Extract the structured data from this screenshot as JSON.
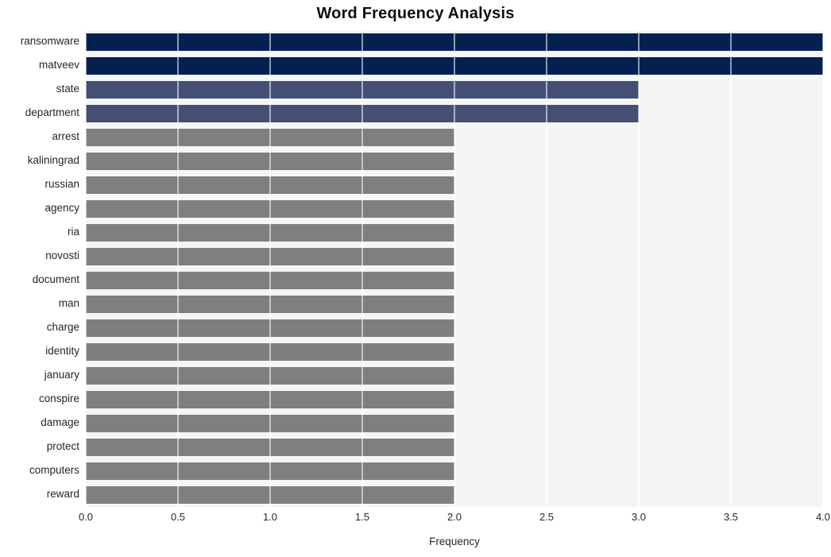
{
  "chart_data": {
    "type": "bar",
    "orientation": "horizontal",
    "title": "Word Frequency Analysis",
    "xlabel": "Frequency",
    "ylabel": "",
    "xlim": [
      0.0,
      4.0
    ],
    "xticks": [
      "0.0",
      "0.5",
      "1.0",
      "1.5",
      "2.0",
      "2.5",
      "3.0",
      "3.5",
      "4.0"
    ],
    "xtick_values": [
      0.0,
      0.5,
      1.0,
      1.5,
      2.0,
      2.5,
      3.0,
      3.5,
      4.0
    ],
    "grid": true,
    "grid_axis": "x",
    "legend": null,
    "categories": [
      "ransomware",
      "matveev",
      "state",
      "department",
      "arrest",
      "kaliningrad",
      "russian",
      "agency",
      "ria",
      "novosti",
      "document",
      "man",
      "charge",
      "identity",
      "january",
      "conspire",
      "damage",
      "protect",
      "computers",
      "reward"
    ],
    "values": [
      4,
      4,
      3,
      3,
      2,
      2,
      2,
      2,
      2,
      2,
      2,
      2,
      2,
      2,
      2,
      2,
      2,
      2,
      2,
      2
    ],
    "bar_colors": [
      "#042050",
      "#042050",
      "#454f74",
      "#454f74",
      "#7f7f7f",
      "#7f7f7f",
      "#7f7f7f",
      "#7f7f7f",
      "#7f7f7f",
      "#7f7f7f",
      "#7f7f7f",
      "#7f7f7f",
      "#7f7f7f",
      "#7f7f7f",
      "#7f7f7f",
      "#7f7f7f",
      "#7f7f7f",
      "#7f7f7f",
      "#7f7f7f",
      "#7f7f7f"
    ]
  },
  "style": {
    "figure_background": "#ffffff",
    "plot_background": "#f5f5f6",
    "gridline_color": "#ffffff",
    "title_color": "#0f0f0f",
    "tick_label_color": "#262626",
    "color_high": "#042050",
    "color_mid": "#454f74",
    "color_low": "#7f7f7f"
  }
}
